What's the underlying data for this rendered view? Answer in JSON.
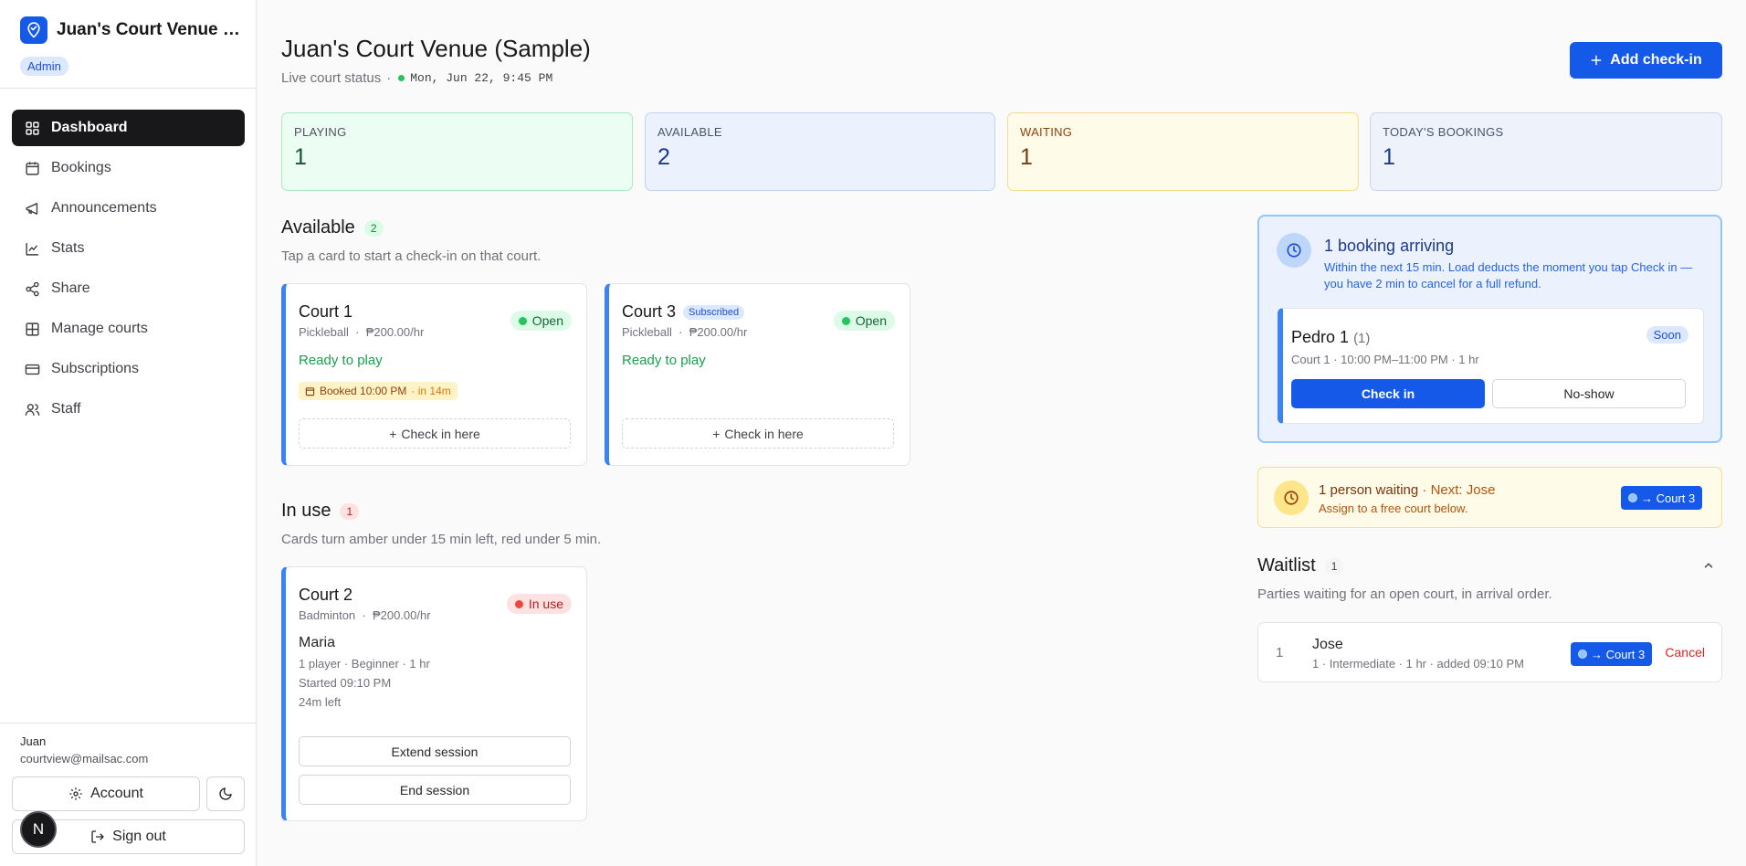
{
  "sidebar": {
    "venue_name": "Juan's Court Venue (Sample)",
    "role": "Admin",
    "nav": [
      {
        "label": "Dashboard",
        "icon": "grid-icon",
        "active": true
      },
      {
        "label": "Bookings",
        "icon": "calendar-icon"
      },
      {
        "label": "Announcements",
        "icon": "megaphone-icon"
      },
      {
        "label": "Stats",
        "icon": "chart-icon"
      },
      {
        "label": "Share",
        "icon": "share-icon"
      },
      {
        "label": "Manage courts",
        "icon": "layout-icon"
      },
      {
        "label": "Subscriptions",
        "icon": "card-icon"
      },
      {
        "label": "Staff",
        "icon": "users-icon"
      }
    ],
    "user": {
      "name": "Juan",
      "email": "courtview@mailsac.com"
    },
    "account_label": "Account",
    "signout_label": "Sign out",
    "dev_badge": "N"
  },
  "header": {
    "title": "Juan's Court Venue (Sample)",
    "subtitle": "Live court status",
    "separator": "·",
    "clock": "Mon, Jun 22, 9:45 PM",
    "add_checkin_label": "Add check-in"
  },
  "stats": [
    {
      "label": "PLAYING",
      "value": "1"
    },
    {
      "label": "AVAILABLE",
      "value": "2"
    },
    {
      "label": "WAITING",
      "value": "1"
    },
    {
      "label": "TODAY'S BOOKINGS",
      "value": "1"
    }
  ],
  "available": {
    "title": "Available",
    "count": "2",
    "subtitle": "Tap a card to start a check-in on that court.",
    "courts": [
      {
        "name": "Court 1",
        "sport": "Pickleball",
        "rate": "₱200.00/hr",
        "status": "Open",
        "ready": "Ready to play",
        "booked_label": "Booked 10:00 PM",
        "booked_eta": "· in 14m",
        "action": "Check in here"
      },
      {
        "name": "Court 3",
        "badge": "Subscribed",
        "sport": "Pickleball",
        "rate": "₱200.00/hr",
        "status": "Open",
        "ready": "Ready to play",
        "action": "Check in here"
      }
    ]
  },
  "in_use": {
    "title": "In use",
    "count": "1",
    "subtitle": "Cards turn amber under 15 min left, red under 5 min.",
    "court": {
      "name": "Court 2",
      "sport": "Badminton",
      "rate": "₱200.00/hr",
      "status": "In use",
      "player": "Maria",
      "details": "1 player · Beginner · 1 hr",
      "started": "Started 09:10 PM",
      "left": "24m left",
      "extend_label": "Extend session",
      "end_label": "End session"
    }
  },
  "arriving": {
    "title": "1 booking arriving",
    "subtitle": "Within the next 15 min. Load deducts the moment you tap Check in — you have 2 min to cancel for a full refund.",
    "booking": {
      "name": "Pedro 1",
      "party": "(1)",
      "meta": "Court 1 · 10:00 PM–11:00 PM · 1 hr",
      "badge": "Soon",
      "checkin_label": "Check in",
      "noshow_label": "No-show"
    }
  },
  "waiting_bar": {
    "title": "1 person waiting",
    "next": "· Next: Jose",
    "subtitle": "Assign to a free court below.",
    "assign_label": "→ Court 3"
  },
  "waitlist": {
    "title": "Waitlist",
    "count": "1",
    "subtitle": "Parties waiting for an open court, in arrival order.",
    "entries": [
      {
        "index": "1",
        "name": "Jose",
        "meta": "1 · Intermediate · 1 hr · added 09:10 PM",
        "assign_label": "→ Court 3",
        "cancel_label": "Cancel"
      }
    ]
  },
  "colors": {
    "primary": "#1459e8",
    "court_stripe": "#3b82f6",
    "open": "#22c55e",
    "in_use": "#ef4444"
  }
}
